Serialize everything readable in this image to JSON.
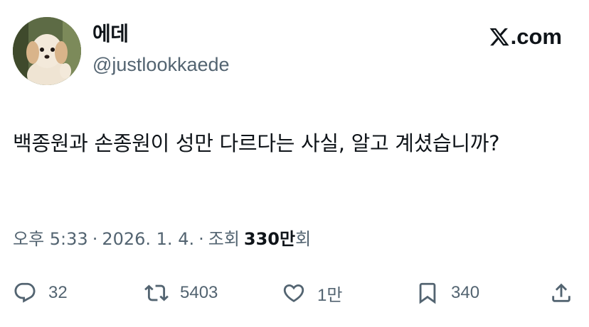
{
  "author": {
    "display_name": "에데",
    "handle": "@justlookkaede",
    "avatar_icon": "puppy-avatar"
  },
  "brand": {
    "label": ".com",
    "icon": "x-logo-icon"
  },
  "tweet": {
    "text": "백종원과 손종원이 성만 다르다는 사실,  알고 계셨습니까?"
  },
  "meta": {
    "time": "오후 5:33",
    "separator": "·",
    "date": "2026. 1. 4.",
    "views_prefix": "조회",
    "views_count": "330만",
    "views_suffix": "회"
  },
  "actions": {
    "reply": {
      "count": "32",
      "icon": "reply-bubble-icon"
    },
    "retweet": {
      "count": "5403",
      "icon": "retweet-icon"
    },
    "like": {
      "count": "1만",
      "icon": "heart-icon"
    },
    "bookmark": {
      "count": "340",
      "icon": "bookmark-icon"
    },
    "share": {
      "icon": "share-icon"
    }
  },
  "colors": {
    "text": "#0f1419",
    "secondary": "#536471",
    "background": "#ffffff"
  }
}
